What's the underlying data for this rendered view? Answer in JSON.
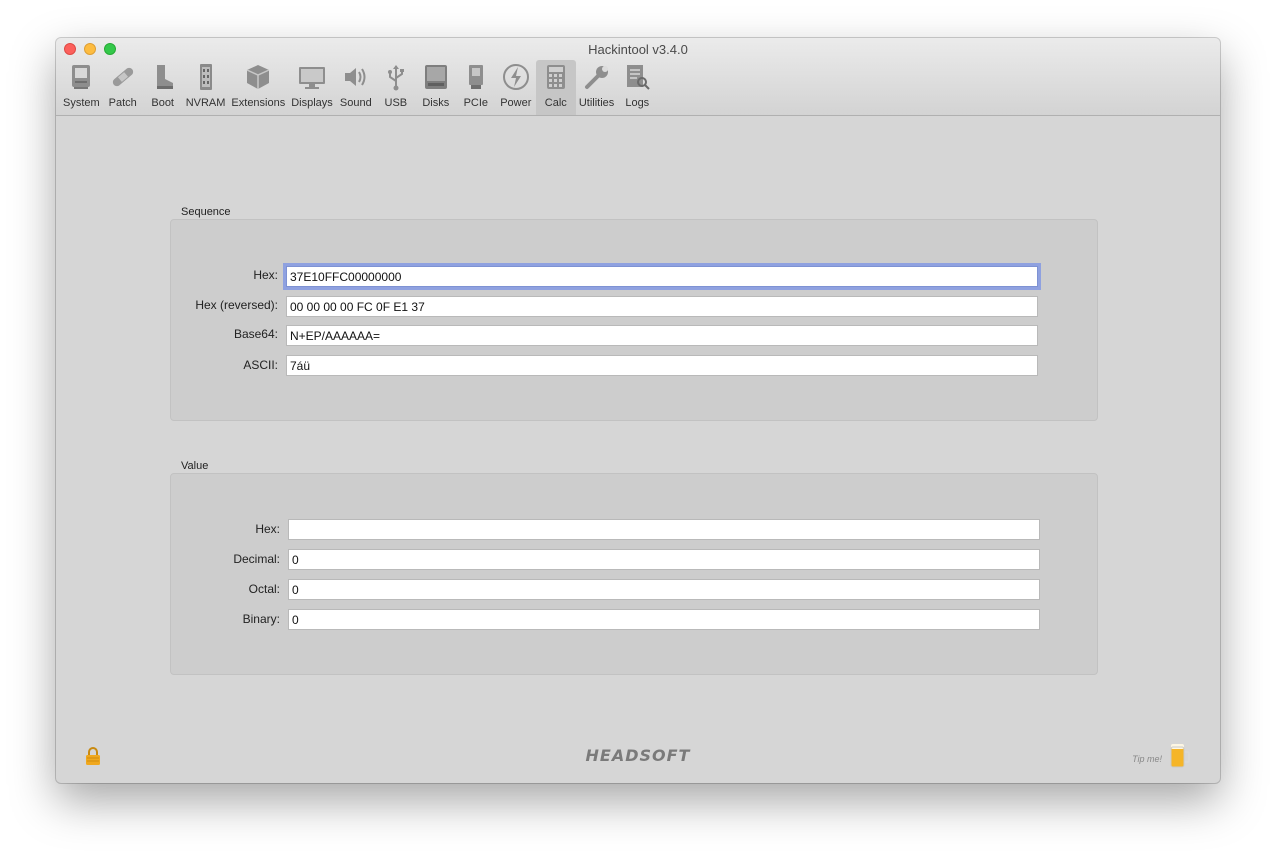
{
  "window": {
    "title": "Hackintool v3.4.0"
  },
  "toolbar": {
    "items": [
      {
        "label": "System",
        "icon": "system-icon"
      },
      {
        "label": "Patch",
        "icon": "patch-icon"
      },
      {
        "label": "Boot",
        "icon": "boot-icon"
      },
      {
        "label": "NVRAM",
        "icon": "nvram-icon"
      },
      {
        "label": "Extensions",
        "icon": "extensions-icon"
      },
      {
        "label": "Displays",
        "icon": "displays-icon"
      },
      {
        "label": "Sound",
        "icon": "sound-icon"
      },
      {
        "label": "USB",
        "icon": "usb-icon"
      },
      {
        "label": "Disks",
        "icon": "disks-icon"
      },
      {
        "label": "PCIe",
        "icon": "pcie-icon"
      },
      {
        "label": "Power",
        "icon": "power-icon"
      },
      {
        "label": "Calc",
        "icon": "calc-icon"
      },
      {
        "label": "Utilities",
        "icon": "utilities-icon"
      },
      {
        "label": "Logs",
        "icon": "logs-icon"
      }
    ],
    "active": "Calc"
  },
  "sequence": {
    "title": "Sequence",
    "hex_label": "Hex:",
    "hex_value": "37E10FFC00000000",
    "hex_reversed_label": "Hex (reversed):",
    "hex_reversed_value": "00 00 00 00 FC 0F E1 37",
    "base64_label": "Base64:",
    "base64_value": "N+EP/AAAAAA=",
    "ascii_label": "ASCII:",
    "ascii_value": "7áü"
  },
  "value": {
    "title": "Value",
    "hex_label": "Hex:",
    "hex_value": "",
    "decimal_label": "Decimal:",
    "decimal_value": "0",
    "octal_label": "Octal:",
    "octal_value": "0",
    "binary_label": "Binary:",
    "binary_value": "0"
  },
  "footer": {
    "brand": "HEADSOFT",
    "tip_label": "Tip me!"
  }
}
